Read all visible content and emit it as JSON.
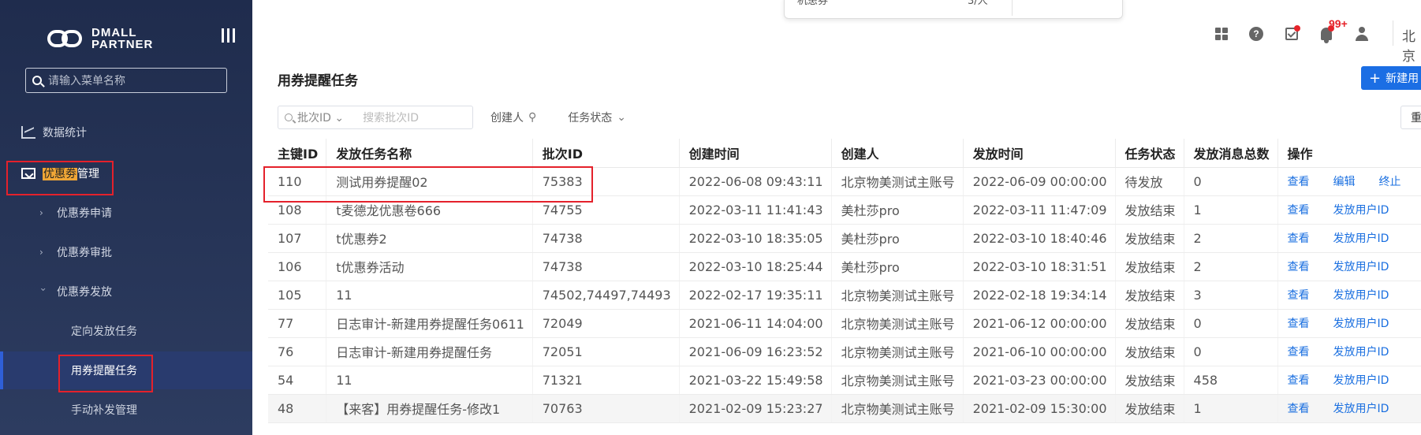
{
  "app": {
    "logo_line1": "DMALL",
    "logo_line2": "PARTNER",
    "menu_search_placeholder": "请输入菜单名称"
  },
  "sidebar": {
    "items": [
      {
        "label": "数据统计",
        "icon": "chart-icon"
      },
      {
        "label_highlight": "优惠劵",
        "label_rest": "管理",
        "icon": "coupon-icon"
      }
    ],
    "sub_items": [
      {
        "label": "优惠券申请",
        "chevron": "›"
      },
      {
        "label": "优惠券审批",
        "chevron": "›"
      },
      {
        "label": "优惠券发放",
        "chevron": "›"
      }
    ],
    "leaves": [
      {
        "label": "定向发放任务"
      },
      {
        "label": "用券提醒任务",
        "active": true
      },
      {
        "label": "手动补发管理"
      }
    ]
  },
  "topbar": {
    "popup_left": "机患券",
    "popup_right": "3/人",
    "badge": "99+",
    "city": "北京"
  },
  "page": {
    "title": "用券提醒任务",
    "new_button": "新建用",
    "new_button_icon": "+"
  },
  "filters": {
    "batch_select": "批次ID",
    "batch_placeholder": "搜索批次ID",
    "creator": "创建人",
    "status": "任务状态",
    "reset": "重"
  },
  "table": {
    "columns": [
      "主键ID",
      "发放任务名称",
      "批次ID",
      "创建时间",
      "创建人",
      "发放时间",
      "任务状态",
      "发放消息总数",
      "操作"
    ],
    "rows": [
      {
        "id": "110",
        "name": "测试用券提醒02",
        "batch": "75383",
        "created": "2022-06-08 09:43:11",
        "creator": "北京物美测试主账号",
        "send_time": "2022-06-09 00:00:00",
        "status": "待发放",
        "count": "0",
        "actions": [
          "查看",
          "编辑",
          "终止"
        ]
      },
      {
        "id": "108",
        "name": "t麦德龙优惠卷666",
        "batch": "74755",
        "created": "2022-03-11 11:41:43",
        "creator": "美杜莎pro",
        "send_time": "2022-03-11 11:47:09",
        "status": "发放结束",
        "count": "1",
        "actions": [
          "查看",
          "发放用户ID"
        ]
      },
      {
        "id": "107",
        "name": "t优惠券2",
        "batch": "74738",
        "created": "2022-03-10 18:35:05",
        "creator": "美杜莎pro",
        "send_time": "2022-03-10 18:40:46",
        "status": "发放结束",
        "count": "2",
        "actions": [
          "查看",
          "发放用户ID"
        ]
      },
      {
        "id": "106",
        "name": "t优惠券活动",
        "batch": "74738",
        "created": "2022-03-10 18:25:44",
        "creator": "美杜莎pro",
        "send_time": "2022-03-10 18:31:51",
        "status": "发放结束",
        "count": "2",
        "actions": [
          "查看",
          "发放用户ID"
        ]
      },
      {
        "id": "105",
        "name": "11",
        "batch": "74502,74497,74493",
        "created": "2022-02-17 19:35:11",
        "creator": "北京物美测试主账号",
        "send_time": "2022-02-18 19:34:14",
        "status": "发放结束",
        "count": "3",
        "actions": [
          "查看",
          "发放用户ID"
        ]
      },
      {
        "id": "77",
        "name": "日志审计-新建用券提醒任务0611",
        "batch": "72049",
        "created": "2021-06-11 14:04:00",
        "creator": "北京物美测试主账号",
        "send_time": "2021-06-12 00:00:00",
        "status": "发放结束",
        "count": "0",
        "actions": [
          "查看",
          "发放用户ID"
        ]
      },
      {
        "id": "76",
        "name": "日志审计-新建用券提醒任务",
        "batch": "72051",
        "created": "2021-06-09 16:23:52",
        "creator": "北京物美测试主账号",
        "send_time": "2021-06-10 00:00:00",
        "status": "发放结束",
        "count": "0",
        "actions": [
          "查看",
          "发放用户ID"
        ]
      },
      {
        "id": "54",
        "name": "11",
        "batch": "71321",
        "created": "2021-03-22 15:49:58",
        "creator": "北京物美测试主账号",
        "send_time": "2021-03-23 00:00:00",
        "status": "发放结束",
        "count": "458",
        "actions": [
          "查看",
          "发放用户ID"
        ]
      },
      {
        "id": "48",
        "name": "【来客】用券提醒任务-修改1",
        "batch": "70763",
        "created": "2021-02-09 15:23:27",
        "creator": "北京物美测试主账号",
        "send_time": "2021-02-09 15:30:00",
        "status": "发放结束",
        "count": "1",
        "actions": [
          "查看",
          "发放用户ID"
        ],
        "grey": true
      }
    ]
  },
  "colors": {
    "sidebar_bg": "#1f2c4d",
    "accent": "#1b6ee4",
    "annotation_red": "#e4212b",
    "highlight": "#f0a636"
  }
}
